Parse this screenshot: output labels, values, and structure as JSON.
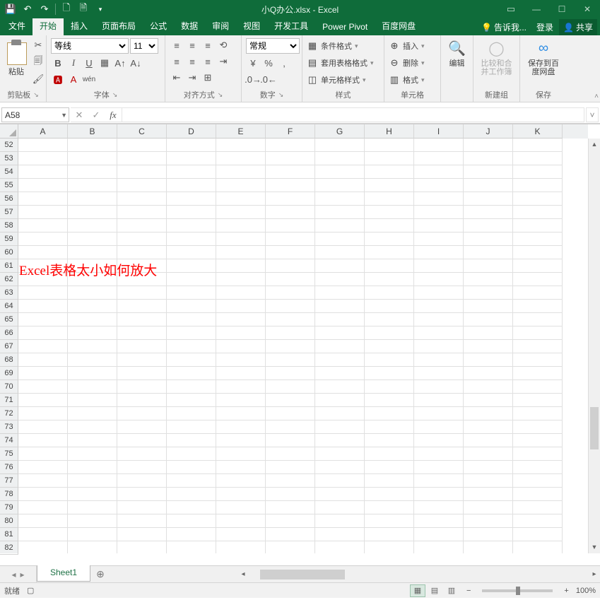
{
  "title": "小Q办公.xlsx - Excel",
  "tabs": [
    "文件",
    "开始",
    "插入",
    "页面布局",
    "公式",
    "数据",
    "审阅",
    "视图",
    "开发工具",
    "Power Pivot",
    "百度网盘"
  ],
  "active_tab": "开始",
  "tellme": "告诉我...",
  "signin": "登录",
  "share": "共享",
  "clipboard": {
    "paste": "粘贴",
    "group": "剪贴板"
  },
  "font": {
    "name": "等线",
    "size": "11",
    "group": "字体"
  },
  "align": {
    "group": "对齐方式"
  },
  "number": {
    "format": "常规",
    "group": "数字"
  },
  "styles": {
    "cond": "条件格式",
    "table": "套用表格格式",
    "cell": "单元格样式",
    "group": "样式"
  },
  "cells": {
    "insert": "插入",
    "delete": "删除",
    "format": "格式",
    "group": "单元格"
  },
  "editing": {
    "edit": "编辑",
    "compare": "比较和合并工作簿",
    "newgroup": "新建组"
  },
  "save": {
    "saveto": "保存到百度网盘",
    "group": "保存"
  },
  "namebox": "A58",
  "columns": [
    "A",
    "B",
    "C",
    "D",
    "E",
    "F",
    "G",
    "H",
    "I",
    "J",
    "K"
  ],
  "rows": [
    "52",
    "53",
    "54",
    "55",
    "56",
    "57",
    "58",
    "59",
    "60",
    "61",
    "62",
    "63",
    "64",
    "65",
    "66",
    "67",
    "68",
    "69",
    "70",
    "71",
    "72",
    "73",
    "74",
    "75",
    "76",
    "77",
    "78",
    "79",
    "80",
    "81",
    "82"
  ],
  "cell_text": "Excel表格太小如何放大",
  "sheet": "Sheet1",
  "status": {
    "ready": "就绪",
    "zoom": "100%"
  }
}
